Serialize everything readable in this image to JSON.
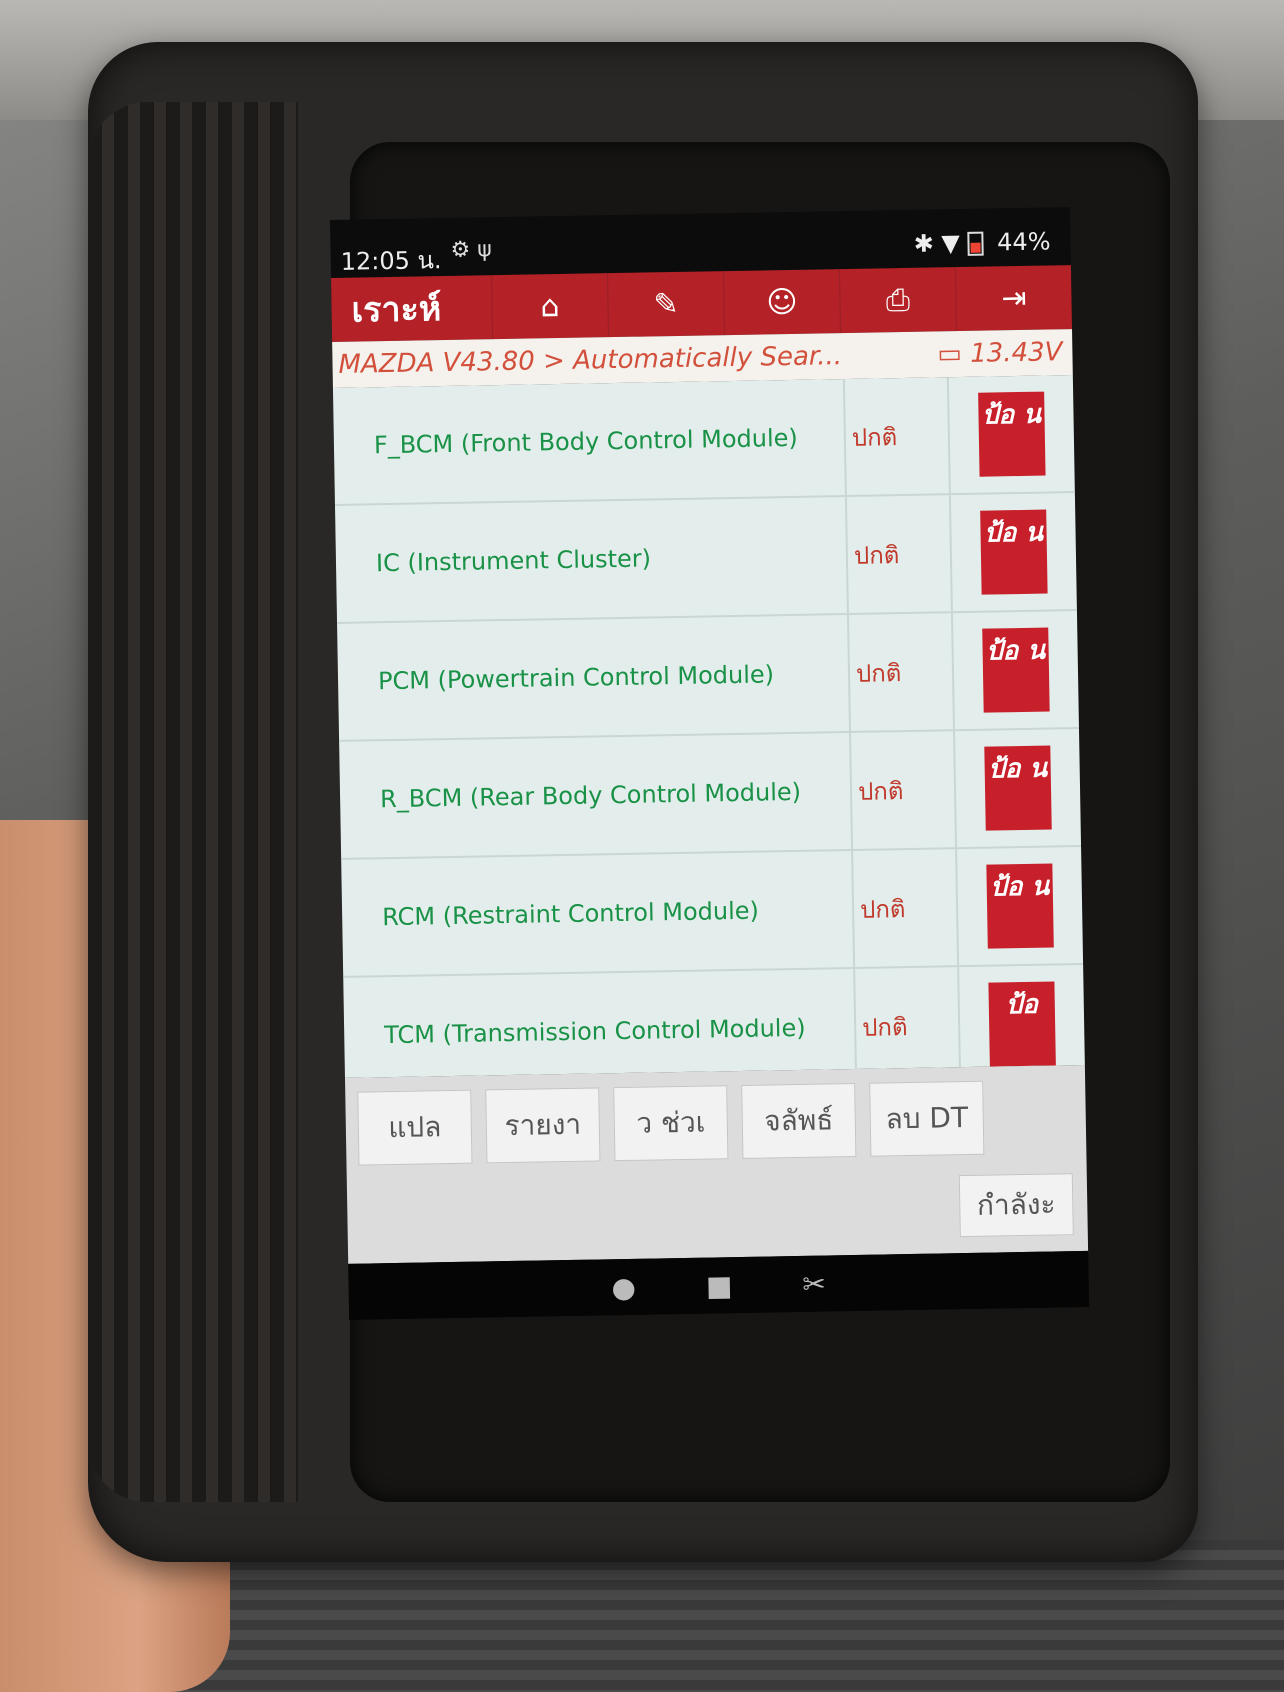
{
  "status_bar": {
    "time": "12:05 น.",
    "left_icons": "⚙ ψ",
    "right_icons": "✱ ▼",
    "battery": "44%"
  },
  "toolbar": {
    "title": "เราะห์",
    "buttons": [
      {
        "icon": "home-icon",
        "glyph": "⌂"
      },
      {
        "icon": "edit-icon",
        "glyph": "✎"
      },
      {
        "icon": "user-icon",
        "glyph": "☺"
      },
      {
        "icon": "print-icon",
        "glyph": "⎙"
      },
      {
        "icon": "exit-icon",
        "glyph": "⇥"
      }
    ]
  },
  "breadcrumb": {
    "path": "MAZDA V43.80 > Automatically Sear...",
    "voltage": "13.43V"
  },
  "modules": [
    {
      "name": "F_BCM (Front Body Control Module)",
      "status": "ปกติ",
      "action": "ป้อ น"
    },
    {
      "name": "IC (Instrument Cluster)",
      "status": "ปกติ",
      "action": "ป้อ น"
    },
    {
      "name": "PCM (Powertrain Control Module)",
      "status": "ปกติ",
      "action": "ป้อ น"
    },
    {
      "name": "R_BCM (Rear Body Control Module)",
      "status": "ปกติ",
      "action": "ป้อ น"
    },
    {
      "name": "RCM (Restraint Control Module)",
      "status": "ปกติ",
      "action": "ป้อ น"
    },
    {
      "name": "TCM (Transmission Control Module)",
      "status": "ปกติ",
      "action": "ป้อ"
    }
  ],
  "bottom_buttons": [
    "แปล",
    "รายงา",
    "ว ช่วเ",
    "จลัพธ์",
    "ลบ DT"
  ],
  "loading_button": "กำลังะ",
  "colors": {
    "accent": "#b42126",
    "module_text": "#199146",
    "status_text": "#c0392b",
    "list_bg": "#e3eeec"
  }
}
